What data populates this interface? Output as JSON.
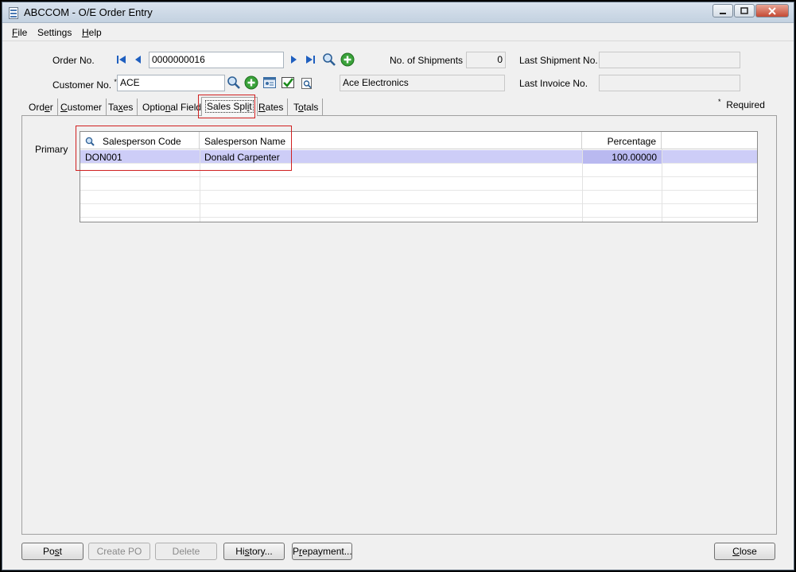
{
  "window": {
    "title": "ABCCOM - O/E Order Entry"
  },
  "menu": [
    {
      "label": "File",
      "acc": "F",
      "rest": "ile"
    },
    {
      "label": "Settings",
      "acc": "",
      "rest": "Settings"
    },
    {
      "label": "Help",
      "acc": "H",
      "rest": "elp"
    }
  ],
  "header": {
    "order_no_label": "Order No.",
    "order_no_value": "0000000016",
    "shipments_label": "No. of Shipments",
    "shipments_value": "0",
    "last_shipment_label": "Last Shipment No.",
    "last_shipment_value": "",
    "customer_no_label": "Customer No.",
    "required_marker": "*",
    "customer_no_value": "ACE",
    "customer_name": "Ace Electronics",
    "last_invoice_label": "Last Invoice No.",
    "last_invoice_value": ""
  },
  "tabs": [
    {
      "label": "Order",
      "pre": "Ord",
      "acc": "e",
      "post": "r"
    },
    {
      "label": "Customer",
      "pre": "",
      "acc": "C",
      "post": "ustomer"
    },
    {
      "label": "Taxes",
      "pre": "Ta",
      "acc": "x",
      "post": "es"
    },
    {
      "label": "Optional Fields",
      "pre": "Optio",
      "acc": "n",
      "post": "al Fields"
    },
    {
      "label": "Sales Split",
      "pre": "Sales Spl",
      "acc": "i",
      "post": "t"
    },
    {
      "label": "Rates",
      "pre": "",
      "acc": "R",
      "post": "ates"
    },
    {
      "label": "Totals",
      "pre": "T",
      "acc": "o",
      "post": "tals"
    }
  ],
  "active_tab": "Sales Split",
  "required_note": {
    "marker": "*",
    "text": "Required"
  },
  "sales_split": {
    "row_label": "Primary",
    "columns": [
      "Salesperson Code",
      "Salesperson Name",
      "Percentage"
    ],
    "rows": [
      {
        "code": "DON001",
        "name": "Donald Carpenter",
        "percentage": "100.00000"
      }
    ]
  },
  "buttons": {
    "post": {
      "pre": "Po",
      "acc": "s",
      "post": "t"
    },
    "create_po": "Create PO",
    "delete": "Delete",
    "history": {
      "pre": "Hi",
      "acc": "s",
      "post": "tory..."
    },
    "prepayment": {
      "pre": "P",
      "acc": "r",
      "post": "epayment..."
    },
    "close": {
      "pre": "",
      "acc": "C",
      "post": "lose"
    }
  },
  "colors": {
    "selected_row": "#cdcdf7",
    "highlight_box": "#d02020",
    "add_icon": "#3aa23a"
  }
}
